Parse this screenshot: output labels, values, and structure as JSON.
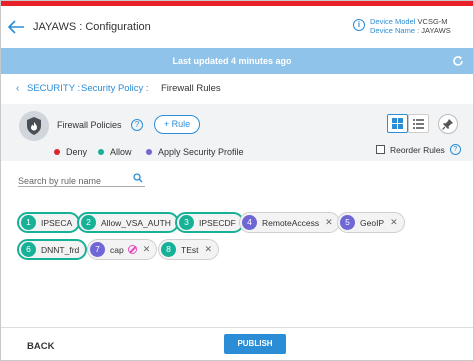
{
  "header": {
    "title": "JAYAWS : Configuration",
    "device_model_label": "Device Model",
    "device_model_value": "VCSG-M",
    "device_name_label": "Device Name :",
    "device_name_value": "JAYAWS"
  },
  "update_bar": {
    "text": "Last updated 4 minutes ago"
  },
  "breadcrumb": {
    "item1": "SECURITY :",
    "item2": "Security Policy :",
    "current": "Firewall Rules"
  },
  "policies": {
    "title": "Firewall Policies",
    "add_rule_label": "+ Rule",
    "legend": [
      {
        "label": "Deny",
        "color": "#d8262c"
      },
      {
        "label": "Allow",
        "color": "#17b197"
      },
      {
        "label": "Apply Security Profile",
        "color": "#6f67d6"
      }
    ],
    "reorder_label": "Reorder Rules"
  },
  "search": {
    "placeholder": "Search by rule name",
    "value": ""
  },
  "rules": [
    {
      "num": "1",
      "name": "IPSECA",
      "kind": "allow",
      "selected": true,
      "removable": false
    },
    {
      "num": "2",
      "name": "Allow_VSA_AUTH",
      "kind": "allow",
      "selected": true,
      "removable": false
    },
    {
      "num": "3",
      "name": "IPSECDF",
      "kind": "allow",
      "selected": true,
      "removable": false
    },
    {
      "num": "4",
      "name": "RemoteAccess",
      "kind": "profile",
      "selected": false,
      "removable": true
    },
    {
      "num": "5",
      "name": "GeoIP",
      "kind": "profile",
      "selected": false,
      "removable": true
    },
    {
      "num": "6",
      "name": "DNNT_frd",
      "kind": "allow",
      "selected": true,
      "removable": false
    },
    {
      "num": "7",
      "name": "cap",
      "kind": "profile",
      "selected": false,
      "removable": true,
      "icon": "block-icon"
    },
    {
      "num": "8",
      "name": "TEst",
      "kind": "allow",
      "selected": false,
      "removable": true
    }
  ],
  "footer": {
    "back_label": "BACK",
    "publish_label": "PUBLISH"
  },
  "colors": {
    "accent": "#2b8dd6",
    "top_bar": "#e8202a",
    "update_bar": "#8fc3ea"
  }
}
